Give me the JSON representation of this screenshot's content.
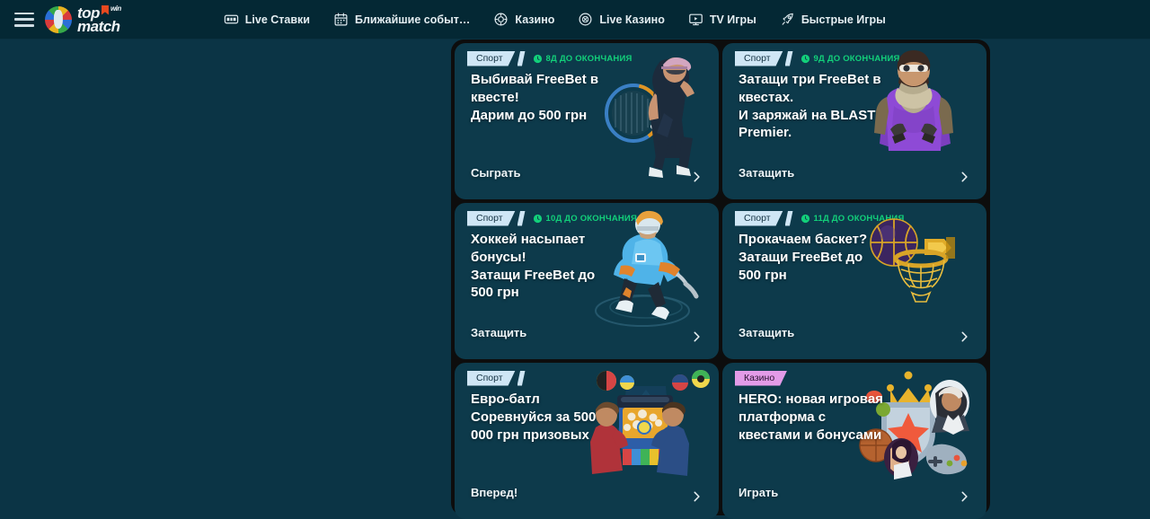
{
  "header": {
    "menu_icon": "hamburger-icon",
    "logo": {
      "top": "top",
      "bottom": "match",
      "flag": "flag-icon",
      "superscript": "win"
    },
    "nav": [
      {
        "label": "Live Ставки",
        "icon": "live-betting-icon"
      },
      {
        "label": "Ближайшие событ…",
        "icon": "calendar-icon"
      },
      {
        "label": "Казино",
        "icon": "casino-chip-icon"
      },
      {
        "label": "Live Казино",
        "icon": "live-casino-icon"
      },
      {
        "label": "TV Игры",
        "icon": "tv-icon"
      },
      {
        "label": "Быстрые Игры",
        "icon": "rocket-icon"
      }
    ]
  },
  "colors": {
    "page_background": "#0b3445",
    "header_background": "#042834",
    "deck_background": "#0d0d0d",
    "card_background": "#0d3a4b",
    "tag_sport": "#cfe6f5",
    "tag_casino": "#e39be8",
    "countdown_green": "#12d07a",
    "title_text": "#ffffff"
  },
  "promos": [
    {
      "tag": "Спорт",
      "tag_type": "sport",
      "countdown": "8Д ДО ОКОНЧАНИЯ",
      "title": "Выбивай FreeBet в\nквесте!\nДарим до 500 грн",
      "cta": "Сыграть",
      "art": "tennis-player-art"
    },
    {
      "tag": "Спорт",
      "tag_type": "sport",
      "countdown": "9Д ДО ОКОНЧАНИЯ",
      "title": "Затащи три FreeBet в\nквестах.\nИ заряжай на BLAST\nPremier.",
      "cta": "Затащить",
      "art": "esports-character-art"
    },
    {
      "tag": "Спорт",
      "tag_type": "sport",
      "countdown": "10Д ДО ОКОНЧАНИЯ",
      "title": "Хоккей насыпает\nбонусы!\nЗатащи FreeBet до\n500 грн",
      "cta": "Затащить",
      "art": "hockey-player-art"
    },
    {
      "tag": "Спорт",
      "tag_type": "sport",
      "countdown": "11Д ДО ОКОНЧАНИЯ",
      "title": "Прокачаем баскет?\nЗатащи FreeBet до\n500 грн",
      "cta": "Затащить",
      "art": "basketball-hoop-art"
    },
    {
      "tag": "Спорт",
      "tag_type": "sport",
      "countdown": "",
      "title": "Евро-батл\nСоревнуйся за 500\n000 грн призовых",
      "cta": "Вперед!",
      "art": "euro-battle-art"
    },
    {
      "tag": "Казино",
      "tag_type": "casino",
      "countdown": "",
      "title": "HERO: новая игровая\nплатформа с\nквестами и бонусами",
      "cta": "Играть",
      "art": "hero-platform-art"
    }
  ]
}
